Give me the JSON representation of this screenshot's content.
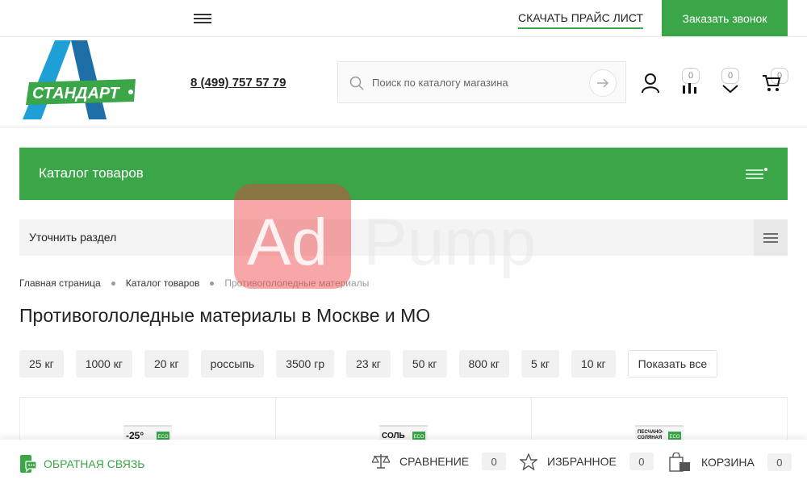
{
  "topbar": {
    "price_list_link": "СКАЧАТЬ ПРАЙС ЛИСТ",
    "call_button": "Заказать звонок"
  },
  "header": {
    "logo_text": "СТАНДАРТ",
    "phone": "8 (499) 757 57 79",
    "search_placeholder": "Поиск по каталогу магазина",
    "compare_count": "0",
    "favorites_count": "0",
    "cart_count": "0"
  },
  "catalog": {
    "title": "Каталог товаров",
    "refine_label": "Уточнить раздел"
  },
  "breadcrumb": {
    "items": [
      "Главная страница",
      "Каталог товаров"
    ],
    "current": "Противогололедные материалы"
  },
  "page_title": "Противогололедные материалы в Москве и МО",
  "tags": [
    "25 кг",
    "1000 кг",
    "20 кг",
    "россыпь",
    "3500 гр",
    "23 кг",
    "50 кг",
    "800 кг",
    "5 кг",
    "10 кг"
  ],
  "show_all": "Показать все",
  "products": [
    {
      "pack_label": "-25°",
      "badge": "ECO"
    },
    {
      "pack_label": "СОЛЬ",
      "badge": "ECO"
    },
    {
      "pack_label": "ПЕСЧАНО-СОЛЯНАЯ",
      "badge": "ECO"
    }
  ],
  "bottombar": {
    "feedback": "ОБРАТНАЯ СВЯЗЬ",
    "compare_label": "СРАВНЕНИЕ",
    "compare_count": "0",
    "favorites_label": "ИЗБРАННОЕ",
    "favorites_count": "0",
    "cart_label": "КОРЗИНА",
    "cart_count": "0"
  },
  "watermark": {
    "text_left": "Ad",
    "text_right": "Pump"
  },
  "colors": {
    "brand_green": "#3aa647",
    "logo_blue": "#1e6fa8"
  }
}
